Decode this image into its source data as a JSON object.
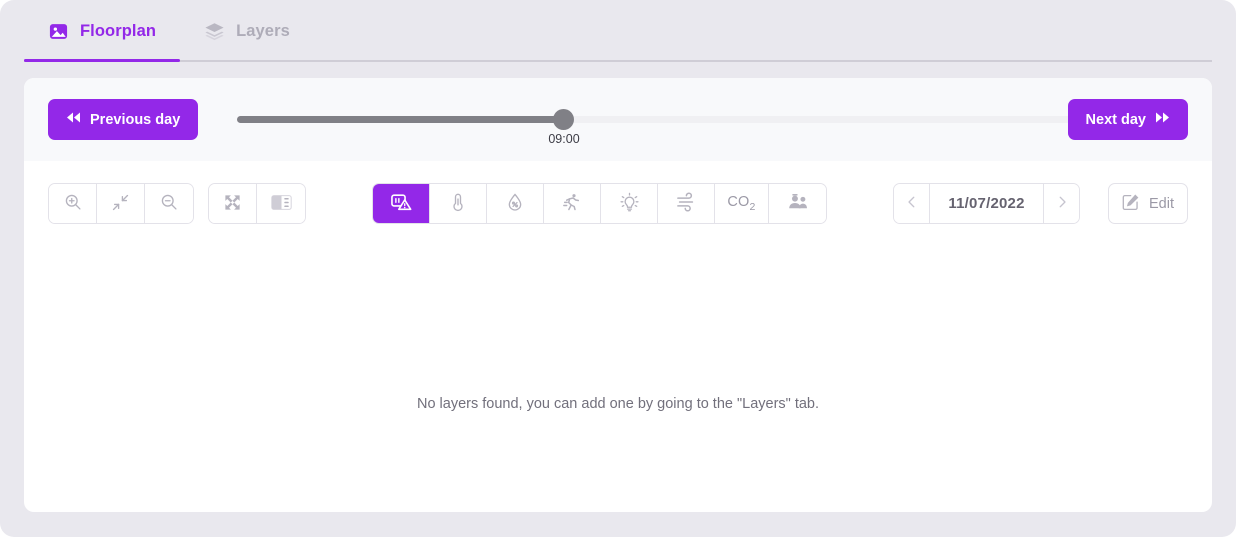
{
  "tabs": [
    {
      "label": "Floorplan",
      "icon": "image-icon",
      "active": true
    },
    {
      "label": "Layers",
      "icon": "layers-icon",
      "active": false
    }
  ],
  "timeline": {
    "previous_day_label": "Previous day",
    "next_day_label": "Next day",
    "previous_icon": "rewind-icon",
    "next_icon": "fast-forward-icon",
    "current_time": "09:00",
    "slider_percent": 39
  },
  "zoom_controls": [
    {
      "name": "zoom-in-button",
      "icon": "magnifier-plus-icon"
    },
    {
      "name": "zoom-reset-button",
      "icon": "collapse-arrows-icon"
    },
    {
      "name": "zoom-out-button",
      "icon": "magnifier-minus-icon"
    }
  ],
  "view_controls": [
    {
      "name": "fullscreen-button",
      "icon": "expand-arrows-icon"
    },
    {
      "name": "toggle-panel-button",
      "icon": "side-panel-icon"
    }
  ],
  "sensor_filters": [
    {
      "name": "alerts-filter",
      "icon": "device-alert-icon",
      "label": "",
      "active": true
    },
    {
      "name": "temperature-filter",
      "icon": "thermometer-icon",
      "label": "",
      "active": false
    },
    {
      "name": "humidity-filter",
      "icon": "humidity-droplet-icon",
      "label": "",
      "active": false
    },
    {
      "name": "motion-filter",
      "icon": "running-person-icon",
      "label": "",
      "active": false
    },
    {
      "name": "light-filter",
      "icon": "lightbulb-icon",
      "label": "",
      "active": false
    },
    {
      "name": "airflow-filter",
      "icon": "wind-icon",
      "label": "",
      "active": false
    },
    {
      "name": "co2-filter",
      "icon": "co2-text-icon",
      "label": "CO",
      "sub": "2",
      "active": false
    },
    {
      "name": "occupancy-filter",
      "icon": "people-icon",
      "label": "",
      "active": false
    }
  ],
  "date_nav": {
    "prev_icon": "chevron-left-icon",
    "next_icon": "chevron-right-icon",
    "date": "11/07/2022"
  },
  "edit_button": {
    "label": "Edit",
    "icon": "pencil-square-icon"
  },
  "empty_state": {
    "message": "No layers found, you can add one by going to the \"Layers\" tab."
  },
  "colors": {
    "accent": "#9328e8",
    "page_background": "#e9e8ee",
    "card_background": "#ffffff",
    "slider_row_background": "#f8f9fb",
    "icon_gray": "#b5b3be",
    "text_gray": "#72707c"
  }
}
